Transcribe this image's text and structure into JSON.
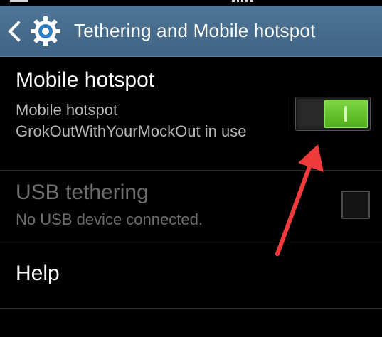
{
  "action_bar": {
    "title": "Tethering and Mobile hotspot",
    "back_icon": "chevron-left-icon",
    "app_icon": "gear-icon",
    "background_color": "#45698a"
  },
  "settings": {
    "mobile_hotspot": {
      "title": "Mobile hotspot",
      "summary": "Mobile hotspot GrokOutWithYourMockOut in use",
      "switch_on": true,
      "switch_color": "#5cbf22"
    },
    "usb_tethering": {
      "title": "USB tethering",
      "summary": "No USB device connected.",
      "enabled": false,
      "checked": false
    },
    "help": {
      "title": "Help"
    }
  },
  "annotation": {
    "type": "arrow",
    "color": "#ef3b3b"
  }
}
